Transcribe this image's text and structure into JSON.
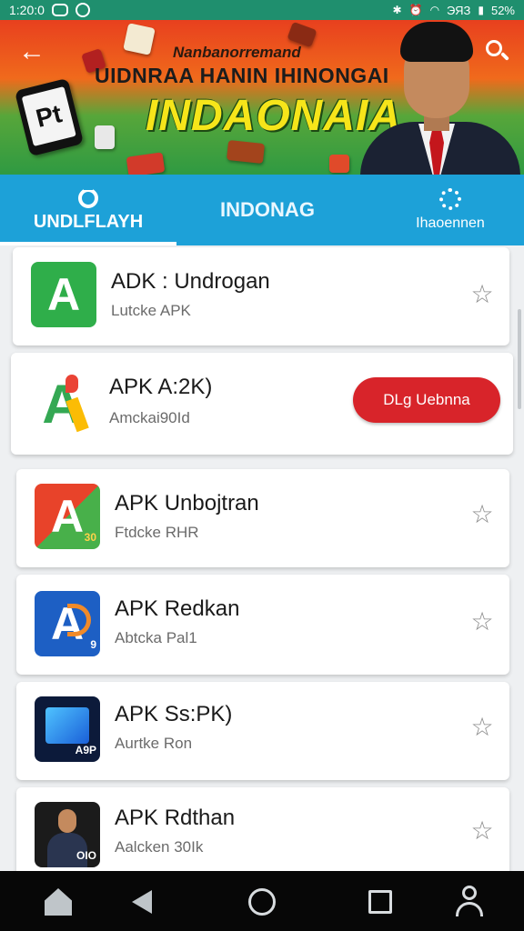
{
  "status_bar": {
    "time": "1:20:0",
    "battery": "52%",
    "signal": "ЭЯЗ"
  },
  "banner": {
    "subtitle": "Nanbanorremand",
    "headline": "UIDNRAA HANIN IHINONGAI",
    "main_title": "INDAONAIA",
    "phone_text": "Pt"
  },
  "tabs": [
    {
      "label": "UNDLFLAYH",
      "active": true
    },
    {
      "label": "INDONAG",
      "active": false
    },
    {
      "label": "Ihaoennen",
      "active": false
    }
  ],
  "apps": [
    {
      "title": "ADK : Undrogan",
      "subtitle": "Lutcke APK",
      "icon": "apk-green-icon",
      "action": "star"
    },
    {
      "title": "APK A:2K)",
      "subtitle": "Amckai90Id",
      "icon": "apk-multicolor-icon",
      "action": "button",
      "button_label": "DLg Uebnna"
    },
    {
      "title": "APK Unbojtran",
      "subtitle": "Ftdcke RHR",
      "icon": "apk-red-icon",
      "action": "star",
      "badge": "30"
    },
    {
      "title": "APK Redkan",
      "subtitle": "Abtcka Pal1",
      "icon": "apk-blue-icon",
      "action": "star",
      "badge": "9"
    },
    {
      "title": "APK Ss:PK)",
      "subtitle": "Aurtke Ron",
      "icon": "apk-screen-icon",
      "action": "star",
      "badge": "A9P"
    },
    {
      "title": "APK Rdthan",
      "subtitle": "Aalcken 30Ik",
      "icon": "apk-person-icon",
      "action": "star",
      "badge": "OIO"
    }
  ],
  "colors": {
    "tabbar": "#1da1d8",
    "status_bar": "#1f8f6e",
    "download_button": "#d8242a",
    "banner_title": "#f6e51a"
  },
  "icons": [
    "back-arrow-icon",
    "search-icon",
    "star-icon",
    "home-icon",
    "back-icon",
    "circle-home-icon",
    "recents-icon",
    "profile-icon"
  ]
}
